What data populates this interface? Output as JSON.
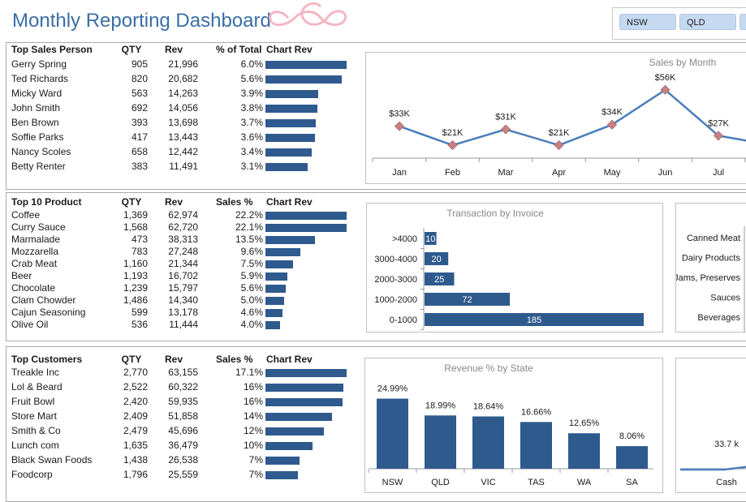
{
  "header": {
    "title": "Monthly Reporting Dashboard",
    "slicer_items": [
      "NSW",
      "QLD",
      ""
    ]
  },
  "colors": {
    "accent": "#2f5a8e",
    "title": "#3a6ea5",
    "line": "#4a7ebb",
    "logo": "#f4b6c2"
  },
  "sales_table": {
    "headers": [
      "Top Sales Person",
      "QTY",
      "Rev",
      "% of Total",
      "Chart Rev"
    ],
    "rows": [
      {
        "name": "Gerry Spring",
        "qty": "905",
        "rev": "21,996",
        "pct": "6.0%",
        "value": 21996
      },
      {
        "name": "Ted Richards",
        "qty": "820",
        "rev": "20,682",
        "pct": "5.6%",
        "value": 20682
      },
      {
        "name": "Micky Ward",
        "qty": "563",
        "rev": "14,263",
        "pct": "3.9%",
        "value": 14263
      },
      {
        "name": "John Smith",
        "qty": "692",
        "rev": "14,056",
        "pct": "3.8%",
        "value": 14056
      },
      {
        "name": "Ben Brown",
        "qty": "393",
        "rev": "13,698",
        "pct": "3.7%",
        "value": 13698
      },
      {
        "name": "Soffie Parks",
        "qty": "417",
        "rev": "13,443",
        "pct": "3.6%",
        "value": 13443
      },
      {
        "name": "Nancy Scoles",
        "qty": "658",
        "rev": "12,442",
        "pct": "3.4%",
        "value": 12442
      },
      {
        "name": "Betty Renter",
        "qty": "383",
        "rev": "11,491",
        "pct": "3.1%",
        "value": 11491
      }
    ]
  },
  "product_table": {
    "headers": [
      "Top 10 Product",
      "QTY",
      "Rev",
      "Sales %",
      "Chart Rev"
    ],
    "rows": [
      {
        "name": "Coffee",
        "qty": "1,369",
        "rev": "62,974",
        "pct": "22.2%",
        "value": 62974
      },
      {
        "name": "Curry Sauce",
        "qty": "1,568",
        "rev": "62,720",
        "pct": "22.1%",
        "value": 62720
      },
      {
        "name": "Marmalade",
        "qty": "473",
        "rev": "38,313",
        "pct": "13.5%",
        "value": 38313
      },
      {
        "name": "Mozzarella",
        "qty": "783",
        "rev": "27,248",
        "pct": "9.6%",
        "value": 27248
      },
      {
        "name": "Crab Meat",
        "qty": "1,160",
        "rev": "21,344",
        "pct": "7.5%",
        "value": 21344
      },
      {
        "name": "Beer",
        "qty": "1,193",
        "rev": "16,702",
        "pct": "5.9%",
        "value": 16702
      },
      {
        "name": "Chocolate",
        "qty": "1,239",
        "rev": "15,797",
        "pct": "5.6%",
        "value": 15797
      },
      {
        "name": "Clam Chowder",
        "qty": "1,486",
        "rev": "14,340",
        "pct": "5.0%",
        "value": 14340
      },
      {
        "name": "Cajun Seasoning",
        "qty": "599",
        "rev": "13,178",
        "pct": "4.6%",
        "value": 13178
      },
      {
        "name": "Olive Oil",
        "qty": "536",
        "rev": "11,444",
        "pct": "4.0%",
        "value": 11444
      }
    ]
  },
  "customer_table": {
    "headers": [
      "Top Customers",
      "QTY",
      "Rev",
      "Sales %",
      "Chart Rev"
    ],
    "rows": [
      {
        "name": "Treakle Inc",
        "qty": "2,770",
        "rev": "63,155",
        "pct": "17.1%",
        "value": 63155
      },
      {
        "name": "Lol & Beard",
        "qty": "2,522",
        "rev": "60,322",
        "pct": "16%",
        "value": 60322
      },
      {
        "name": "Fruit Bowl",
        "qty": "2,420",
        "rev": "59,935",
        "pct": "16%",
        "value": 59935
      },
      {
        "name": "Store Mart",
        "qty": "2,409",
        "rev": "51,858",
        "pct": "14%",
        "value": 51858
      },
      {
        "name": "Smith & Co",
        "qty": "2,479",
        "rev": "45,696",
        "pct": "12%",
        "value": 45696
      },
      {
        "name": "Lunch com",
        "qty": "1,635",
        "rev": "36,479",
        "pct": "10%",
        "value": 36479
      },
      {
        "name": "Black Swan Foods",
        "qty": "1,438",
        "rev": "26,538",
        "pct": "7%",
        "value": 26538
      },
      {
        "name": "Foodcorp",
        "qty": "1,796",
        "rev": "25,559",
        "pct": "7%",
        "value": 25559
      }
    ]
  },
  "chart_data": [
    {
      "type": "line",
      "title": "Sales by Month",
      "categories": [
        "Jan",
        "Feb",
        "Mar",
        "Apr",
        "May",
        "Jun",
        "Jul"
      ],
      "values": [
        33,
        21,
        31,
        21,
        34,
        56,
        27
      ],
      "labels": [
        "$33K",
        "$21K",
        "$31K",
        "$21K",
        "$34K",
        "$56K",
        "$27K"
      ],
      "ylim": [
        0,
        60
      ]
    },
    {
      "type": "bar",
      "orientation": "horizontal",
      "title": "Transaction by Invoice",
      "categories": [
        ">4000",
        "3000-4000",
        "2000-3000",
        "1000-2000",
        "0-1000"
      ],
      "values": [
        10,
        20,
        25,
        72,
        185
      ]
    },
    {
      "type": "bar",
      "title": "Revenue % by State",
      "categories": [
        "NSW",
        "QLD",
        "VIC",
        "TAS",
        "WA",
        "SA"
      ],
      "values": [
        24.99,
        18.99,
        18.64,
        16.66,
        12.65,
        8.06
      ],
      "labels": [
        "24.99%",
        "18.99%",
        "18.64%",
        "16.66%",
        "12.65%",
        "8.06%"
      ],
      "ylim": [
        0,
        30
      ]
    },
    {
      "type": "bar",
      "orientation": "horizontal",
      "categories": [
        "Canned Meat",
        "Dairy Products",
        "Jams, Preserves",
        "Sauces",
        "Beverages"
      ]
    },
    {
      "type": "line",
      "categories": [
        "Cash"
      ],
      "labels": [
        "33.7 k"
      ]
    }
  ]
}
